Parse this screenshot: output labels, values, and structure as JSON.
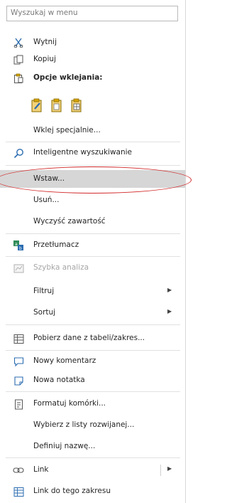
{
  "search": {
    "placeholder": "Wyszukaj w menu"
  },
  "menu": {
    "cut": "Wytnij",
    "copy": "Kopiuj",
    "paste_options": "Opcje wklejania:",
    "paste_special": "Wklej specjalnie...",
    "smart_lookup": "Inteligentne wyszukiwanie",
    "insert": "Wstaw...",
    "delete": "Usuń...",
    "clear_contents": "Wyczyść zawartość",
    "translate": "Przetłumacz",
    "quick_analysis": "Szybka analiza",
    "filter": "Filtruj",
    "sort": "Sortuj",
    "get_data": "Pobierz dane z tabeli/zakres...",
    "new_comment": "Nowy komentarz",
    "new_note": "Nowa notatka",
    "format_cells": "Formatuj komórki...",
    "pick_from_list": "Wybierz z listy rozwijanej...",
    "define_name": "Definiuj nazwę...",
    "link": "Link",
    "link_to_range": "Link do tego zakresu"
  },
  "colors": {
    "highlight": "#d6d6d6",
    "annotation_ellipse": "#d22a2a",
    "icon_blue": "#2b6cb0",
    "icon_green": "#2e8b57",
    "icon_gold": "#d9a400"
  },
  "icons": [
    "scissors-icon",
    "copy-icon",
    "clipboard-icon",
    "paste-brush-icon",
    "paste-values-icon",
    "paste-formatting-icon",
    "search-lightbulb-icon",
    "translate-icon",
    "quick-analysis-icon",
    "table-data-icon",
    "comment-icon",
    "note-icon",
    "format-cells-icon",
    "link-icon",
    "link-range-icon",
    "chevron-right-icon"
  ]
}
